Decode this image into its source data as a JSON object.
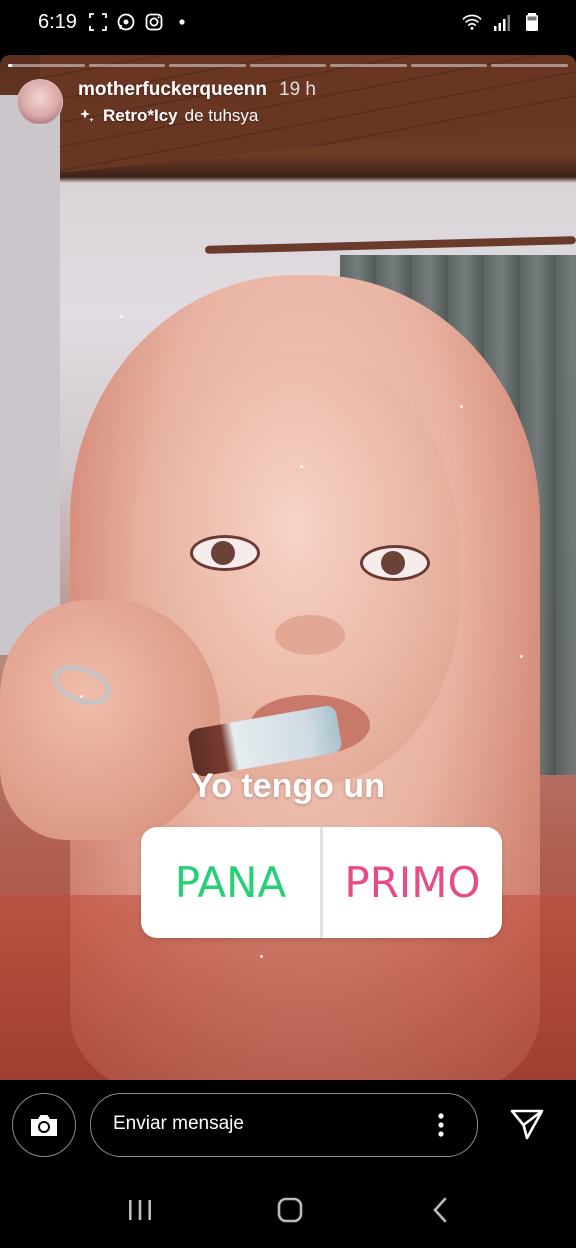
{
  "status_bar": {
    "time": "6:19",
    "left_icons": [
      "screenshot-icon",
      "whatsapp-icon",
      "instagram-icon",
      "dot-icon"
    ],
    "right_icons": [
      "wifi-icon",
      "signal-icon",
      "battery-icon"
    ]
  },
  "story": {
    "segments_total": 7,
    "segments_completed": 0,
    "current_segment_progress": 0.05,
    "username": "motherfuckerqueenn",
    "time_ago": "19 h",
    "effect": {
      "name": "Retro*Icy",
      "suffix": "de tuhsya",
      "icon": "sparkle-icon"
    },
    "quiz": {
      "question": "Yo tengo un",
      "options": [
        "PANA",
        "PRIMO"
      ],
      "option_colors": [
        "#27d077",
        "#e64b8a"
      ]
    }
  },
  "reply_bar": {
    "placeholder": "Enviar mensaje",
    "camera_icon": "camera-icon",
    "more_icon": "more-vertical-icon",
    "send_icon": "send-icon"
  },
  "nav_bar": {
    "buttons": [
      "recent-apps-icon",
      "home-icon",
      "back-icon"
    ]
  }
}
